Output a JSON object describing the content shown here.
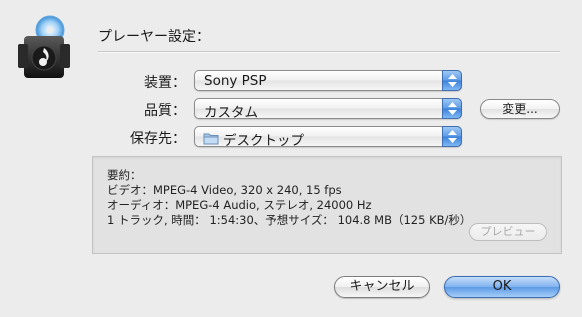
{
  "header": {
    "title": "プレーヤー設定："
  },
  "settings": {
    "device": {
      "label": "装置：",
      "value": "Sony PSP"
    },
    "quality": {
      "label": "品質：",
      "value": "カスタム",
      "change_button": "変更..."
    },
    "save_to": {
      "label": "保存先：",
      "value": "デスクトップ",
      "icon": "folder-icon"
    }
  },
  "summary": {
    "heading": "要約：",
    "video": "ビデオ：MPEG-4 Video, 320 x 240, 15 fps",
    "audio": "オーディオ：MPEG-4 Audio, ステレオ, 24000 Hz",
    "track": "1 トラック, 時間： 1:54:30、予想サイズ： 104.8 MB（125 KB/秒）",
    "preview_button": "プレビュー"
  },
  "footer": {
    "cancel": "キャンセル",
    "ok": "OK"
  },
  "colors": {
    "accent": "#5d9ae6",
    "background": "#ececec"
  }
}
